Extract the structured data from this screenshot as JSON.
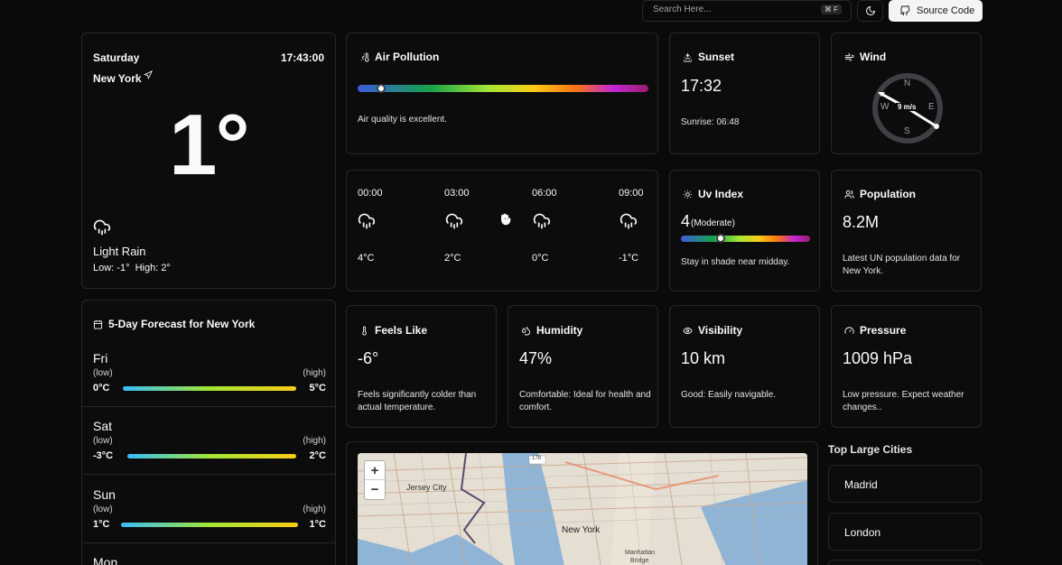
{
  "topbar": {
    "search_placeholder": "Search Here...",
    "shortcut_cmd": "⌘",
    "shortcut_key": "F",
    "source_code_label": "Source Code"
  },
  "current": {
    "day": "Saturday",
    "time": "17:43:00",
    "city": "New York",
    "temperature": "1°",
    "condition": "Light Rain",
    "low_high": "Low: -1°  High: 2°"
  },
  "air_pollution": {
    "title": "Air Pollution",
    "level": 0.08,
    "text": "Air quality is excellent."
  },
  "sunset": {
    "title": "Sunset",
    "time": "17:32",
    "sunrise": "Sunrise: 06:48"
  },
  "wind": {
    "title": "Wind",
    "speed": "9 m/s",
    "n": "N",
    "e": "E",
    "s": "S",
    "w": "W"
  },
  "hourly": [
    {
      "time": "00:00",
      "temp": "4°C"
    },
    {
      "time": "03:00",
      "temp": "2°C"
    },
    {
      "time": "06:00",
      "temp": "0°C"
    },
    {
      "time": "09:00",
      "temp": "-1°C"
    }
  ],
  "uv": {
    "title": "Uv Index",
    "value": "4",
    "label": "(Moderate)",
    "level": 0.31,
    "text": "Stay in shade near midday."
  },
  "population": {
    "title": "Population",
    "value": "8.2M",
    "text": "Latest UN population data for New York."
  },
  "forecast": {
    "title": "5-Day Forecast for New York",
    "low_label": "(low)",
    "high_label": "(high)",
    "days": [
      {
        "day": "Fri",
        "low": "0°C",
        "high": "5°C"
      },
      {
        "day": "Sat",
        "low": "-3°C",
        "high": "2°C"
      },
      {
        "day": "Sun",
        "low": "1°C",
        "high": "1°C"
      },
      {
        "day": "Mon"
      }
    ]
  },
  "feels_like": {
    "title": "Feels Like",
    "value": "-6°",
    "text": "Feels significantly colder than actual temperature."
  },
  "humidity": {
    "title": "Humidity",
    "value": "47%",
    "text": "Comfortable: Ideal for health and comfort."
  },
  "visibility": {
    "title": "Visibility",
    "value": "10 km",
    "text": "Good: Easily navigable."
  },
  "pressure": {
    "title": "Pressure",
    "value": "1009 hPa",
    "text": "Low pressure. Expect weather changes.."
  },
  "map": {
    "zoom_in": "+",
    "zoom_out": "−",
    "label_jersey": "Jersey City",
    "label_newyork": "New York",
    "label_manhattan": "Manhattan",
    "label_bridge": "Bridge",
    "label_route": "178"
  },
  "cities": {
    "title": "Top Large Cities",
    "items": [
      "Madrid",
      "London"
    ]
  },
  "colors": {
    "background": "#0a0a0a",
    "border": "#27272a",
    "accent_white": "#fafafa"
  }
}
